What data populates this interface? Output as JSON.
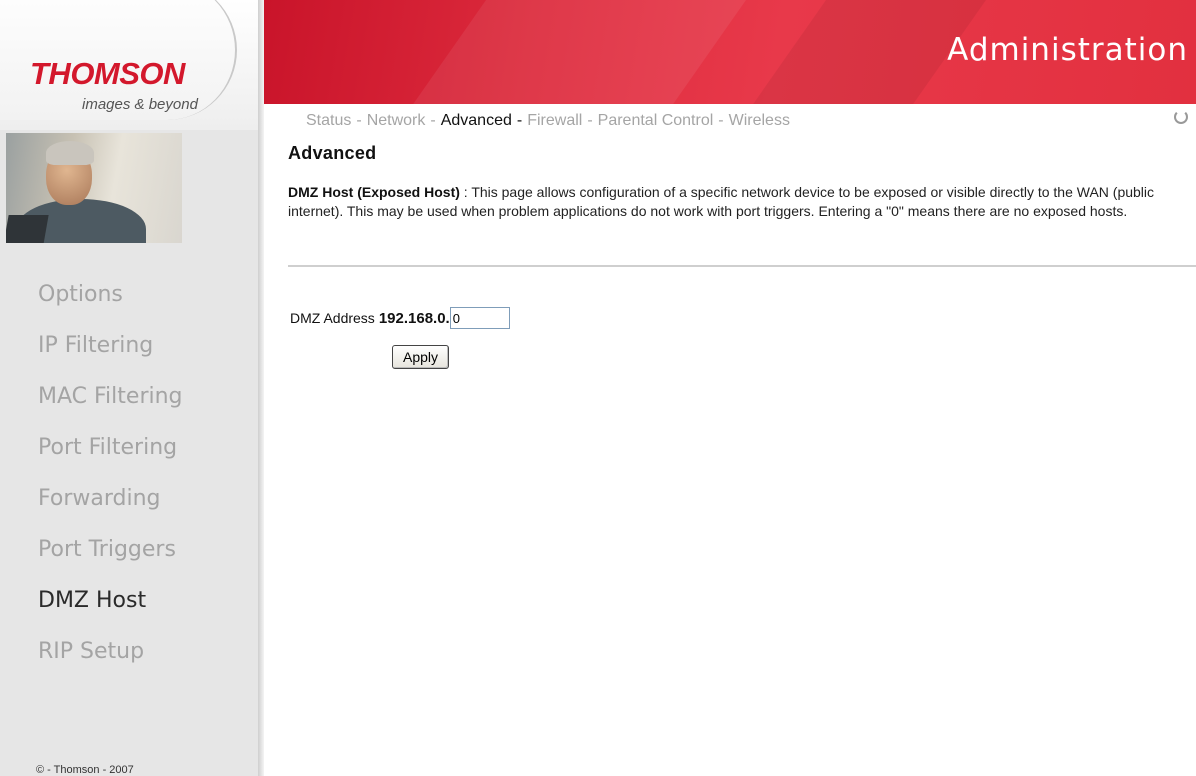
{
  "brand": {
    "logo": "THOMSON",
    "tagline": "images & beyond",
    "accent_color": "#d3182c"
  },
  "header": {
    "title": "Administration"
  },
  "tabs": [
    {
      "label": "Status"
    },
    {
      "label": "Network"
    },
    {
      "label": "Advanced",
      "active": true
    },
    {
      "label": "Firewall"
    },
    {
      "label": "Parental Control"
    },
    {
      "label": "Wireless"
    }
  ],
  "tab_separator": "-",
  "sidebar": {
    "items": [
      {
        "label": "Options"
      },
      {
        "label": "IP Filtering"
      },
      {
        "label": "MAC Filtering"
      },
      {
        "label": "Port Filtering"
      },
      {
        "label": "Forwarding"
      },
      {
        "label": "Port Triggers"
      },
      {
        "label": "DMZ Host",
        "active": true
      },
      {
        "label": "RIP Setup"
      }
    ],
    "copyright": "© - Thomson - 2007"
  },
  "main": {
    "title": "Advanced",
    "desc_heading": "DMZ Host (Exposed Host)",
    "desc_separator": " : ",
    "desc_body": "This page allows configuration of a specific network device to be exposed or visible directly to the WAN (public internet). This may be used when problem applications do not work with port triggers. Entering a \"0\" means there are no exposed hosts.",
    "dmz_label": "DMZ Address",
    "dmz_prefix": "192.168.0.",
    "dmz_value": "0",
    "apply_label": "Apply"
  }
}
